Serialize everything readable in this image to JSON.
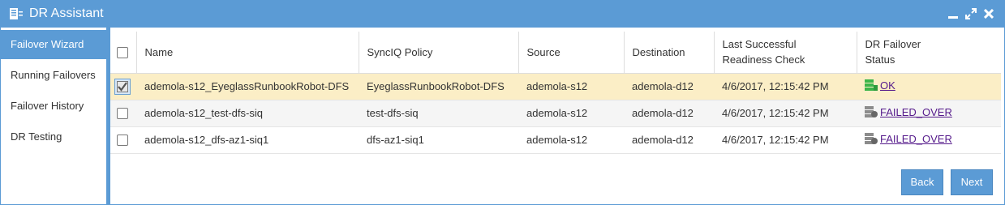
{
  "window": {
    "title": "DR Assistant"
  },
  "sidebar": {
    "items": [
      {
        "label": "Failover Wizard",
        "active": true
      },
      {
        "label": "Running Failovers",
        "active": false
      },
      {
        "label": "Failover History",
        "active": false
      },
      {
        "label": "DR Testing",
        "active": false
      }
    ]
  },
  "table": {
    "columns": {
      "name": "Name",
      "policy": "SyncIQ Policy",
      "source": "Source",
      "destination": "Destination",
      "readiness_line1": "Last Successful",
      "readiness_line2": "Readiness Check",
      "status_line1": "DR Failover",
      "status_line2": "Status"
    },
    "rows": [
      {
        "selected": true,
        "name": "ademola-s12_EyeglassRunbookRobot-DFS",
        "policy": "EyeglassRunbookRobot-DFS",
        "source": "ademola-s12",
        "destination": "ademola-d12",
        "readiness": "4/6/2017, 12:15:42 PM",
        "status": "OK"
      },
      {
        "selected": false,
        "name": "ademola-s12_test-dfs-siq",
        "policy": "test-dfs-siq",
        "source": "ademola-s12",
        "destination": "ademola-d12",
        "readiness": "4/6/2017, 12:15:42 PM",
        "status": "FAILED_OVER"
      },
      {
        "selected": false,
        "name": "ademola-s12_dfs-az1-siq1",
        "policy": "dfs-az1-siq1",
        "source": "ademola-s12",
        "destination": "ademola-d12",
        "readiness": "4/6/2017, 12:15:42 PM",
        "status": "FAILED_OVER"
      }
    ]
  },
  "buttons": {
    "back": "Back",
    "next": "Next"
  },
  "colors": {
    "accent": "#5b9bd5",
    "selected_row": "#fbeec6",
    "ok_icon": "#3cb54a",
    "failed_icon": "#888888"
  }
}
